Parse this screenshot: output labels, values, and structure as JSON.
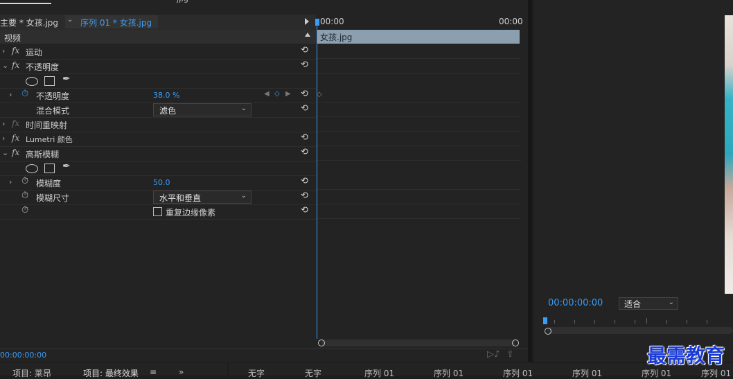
{
  "header": {
    "source_clip": "主要 * 女孩.jpg",
    "sequence": "序列 01 * 女孩.jpg",
    "top_fragment": "jpg"
  },
  "section": {
    "video": "视频"
  },
  "effects": {
    "motion": "运动",
    "opacity": "不透明度",
    "opacity_prop": "不透明度",
    "opacity_value": "38.0 %",
    "blend_label": "混合模式",
    "blend_value": "滤色",
    "time_remap": "时间重映射",
    "lumetri": "Lumetri 颜色",
    "gaussian": "高斯模糊",
    "blurriness": "模糊度",
    "blurriness_value": "50.0",
    "blur_dim_label": "模糊尺寸",
    "blur_dim_value": "水平和垂直",
    "repeat_edge": "重复边缘像素"
  },
  "timeline": {
    "start": "00:00",
    "end": "00:00",
    "clip": "女孩.jpg",
    "timecode": "00:00:00:00"
  },
  "program": {
    "timecode": "00:00:00:00",
    "fit": "适合"
  },
  "bottom_left_tabs": [
    "项目: 莱昂",
    "项目: 最终效果",
    "≡",
    "»"
  ],
  "bottom_right_tabs": [
    "无字",
    "无字",
    "序列 01",
    "序列 01",
    "序列 01",
    "序列 01",
    "序列 01",
    "序列 01"
  ],
  "watermark": "最需教育",
  "colors": {
    "accent": "#3a9df5",
    "clip": "#8b9fae"
  }
}
